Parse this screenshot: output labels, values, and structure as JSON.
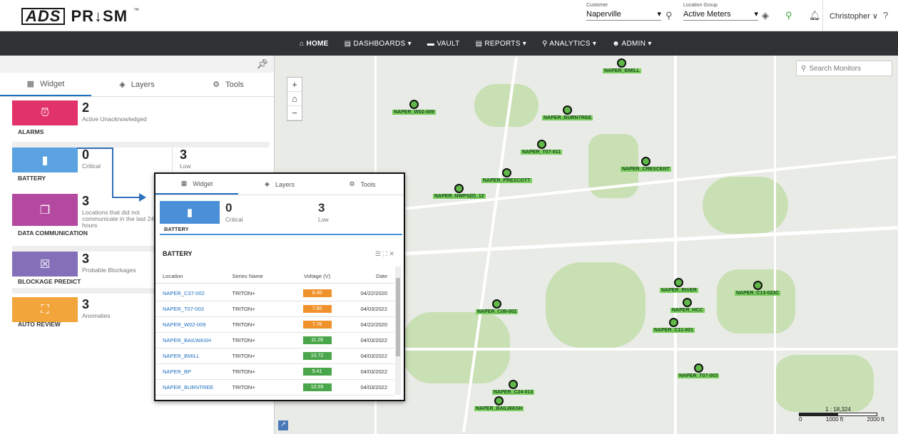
{
  "brand": {
    "ads": "ADS",
    "prism": "PR↓SM",
    "tm": "™"
  },
  "customer": {
    "label": "Customer",
    "value": "Naperville"
  },
  "location_group": {
    "label": "Location Group",
    "value": "Active Meters"
  },
  "user": {
    "name": "Christopher ∨"
  },
  "nav": {
    "home": "HOME",
    "dashboards": "DASHBOARDS ▾",
    "vault": "VAULT",
    "reports": "REPORTS ▾",
    "analytics": "ANALYTICS ▾",
    "admin": "ADMIN ▾"
  },
  "tabs": {
    "widget": "Widget",
    "layers": "Layers",
    "tools": "Tools"
  },
  "widgets": {
    "alarms": {
      "count": "2",
      "desc": "Active Unacknowledged",
      "title": "ALARMS",
      "color": "#e2326a"
    },
    "battery": {
      "critical": "0",
      "critical_label": "Critical",
      "low": "3",
      "low_label": "Low",
      "title": "BATTERY",
      "color": "#5aa3e0"
    },
    "datacomm": {
      "count": "3",
      "desc": "Locations that did not communicate in the last 24 hours",
      "title": "DATA COMMUNICATION",
      "color": "#b44aa0"
    },
    "blockage": {
      "count": "3",
      "desc": "Probable Blockages",
      "title": "BLOCKAGE PREDICT",
      "color": "#8470b8"
    },
    "autoreview": {
      "count": "3",
      "desc": "Anomalies",
      "title": "AUTO REVIEW",
      "color": "#f2a53a"
    }
  },
  "map": {
    "search_placeholder": "Search Monitors",
    "scale_text": "1 : 18,324",
    "scale_0": "0",
    "scale_1000": "1000 ft",
    "scale_2000": "2000 ft"
  },
  "monitors": [
    "NAPER_BMILL",
    "NAPER_W02-009",
    "NAPER_BURNTREE",
    "NAPER_T07-011",
    "NAPER_CRESCENT",
    "NAPER_PRESCOTT",
    "NAPER_NWPS(0)_12",
    "NAPER_C08-002",
    "NAPER_RIVER",
    "NAPER_C13-023C",
    "NAPER_HCC",
    "NAPER_C11-001",
    "NAPER_T07-003",
    "NAPER_C24-013",
    "NAPER_BAILWASH"
  ],
  "popup": {
    "tabs": {
      "widget": "Widget",
      "layers": "Layers",
      "tools": "Tools"
    },
    "battery": {
      "critical": "0",
      "critical_label": "Critical",
      "low": "3",
      "low_label": "Low",
      "title": "BATTERY"
    },
    "table_title": "BATTERY",
    "columns": [
      "Location",
      "Series Name",
      "Voltage (V)",
      "Date"
    ],
    "rows": [
      {
        "location": "NAPER_C37-002",
        "series": "TRITON+",
        "voltage": "8.40",
        "date": "04/22/2020",
        "color": "#f0922b"
      },
      {
        "location": "NAPER_T07-003",
        "series": "TRITON+",
        "voltage": "7.80",
        "date": "04/03/2022",
        "color": "#f0922b"
      },
      {
        "location": "NAPER_W02-009",
        "series": "TRITON+",
        "voltage": "7.76",
        "date": "04/22/2020",
        "color": "#f0922b"
      },
      {
        "location": "NAPER_BAILWASH",
        "series": "TRITON+",
        "voltage": "11.28",
        "date": "04/03/2022",
        "color": "#4aa64a"
      },
      {
        "location": "NAPER_BMILL",
        "series": "TRITON+",
        "voltage": "10.72",
        "date": "04/03/2022",
        "color": "#4aa64a"
      },
      {
        "location": "NAPER_BP",
        "series": "TRITON+",
        "voltage": "9.41",
        "date": "04/03/2022",
        "color": "#4aa64a"
      },
      {
        "location": "NAPER_BURNTREE",
        "series": "TRITON+",
        "voltage": "10.59",
        "date": "04/03/2022",
        "color": "#4aa64a"
      }
    ]
  }
}
